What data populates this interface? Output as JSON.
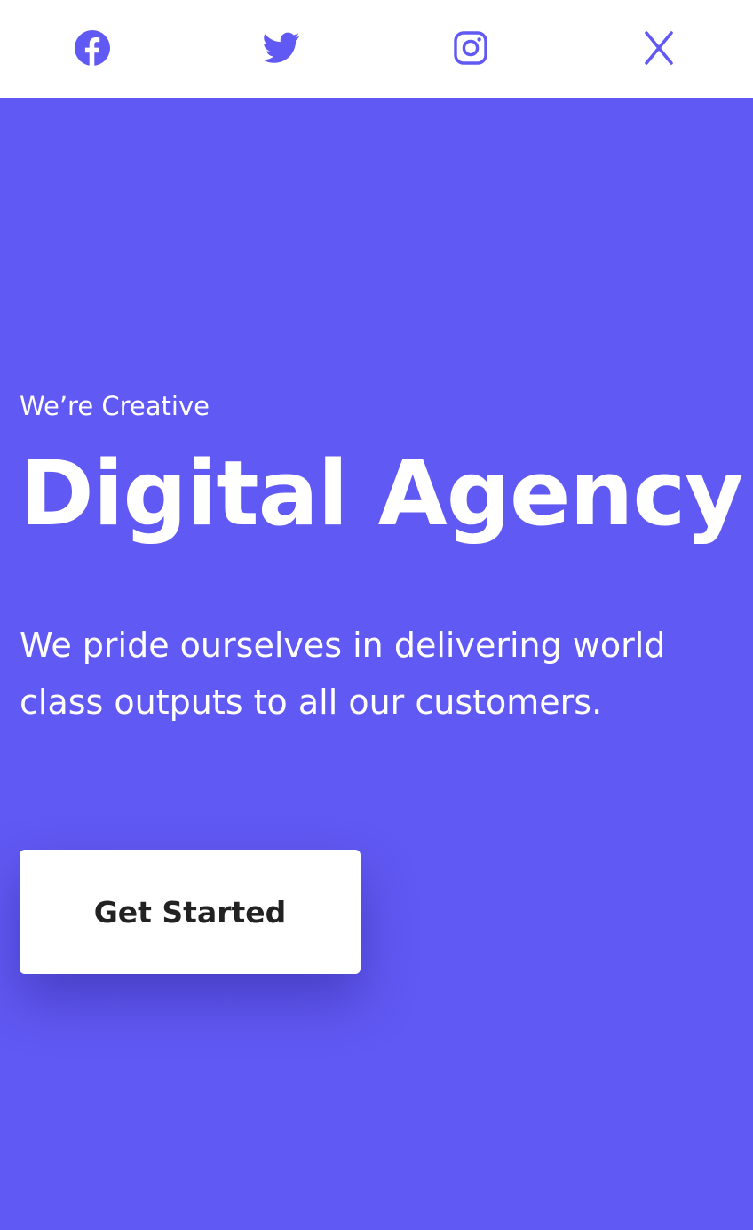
{
  "topbar": {
    "icons": [
      {
        "name": "facebook-icon"
      },
      {
        "name": "twitter-icon"
      },
      {
        "name": "instagram-icon"
      },
      {
        "name": "close-icon"
      }
    ],
    "icon_color": "#6159f3"
  },
  "hero": {
    "background_color": "#6159f3",
    "text_color": "#ffffff",
    "eyebrow": "We’re Creative",
    "headline": "Digital Agency",
    "tagline": "We pride ourselves in delivering world class outputs to all our customers.",
    "cta_label": "Get Started"
  }
}
